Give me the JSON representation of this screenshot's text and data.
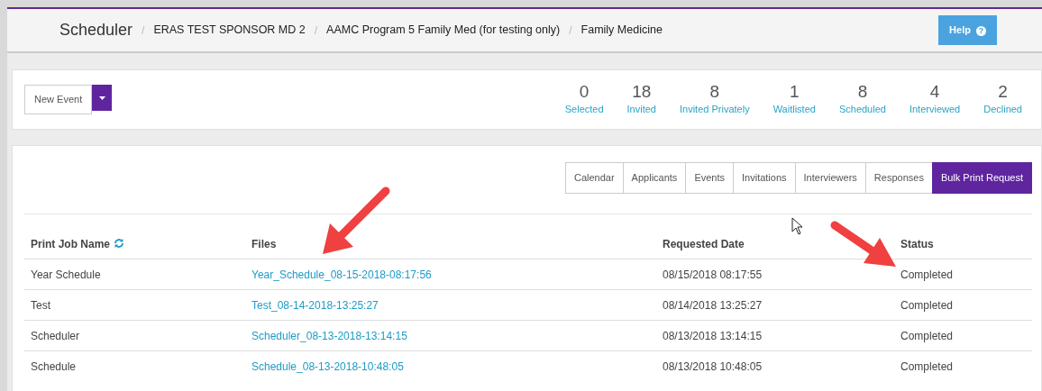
{
  "breadcrumb": [
    {
      "label": "Scheduler"
    },
    {
      "label": "ERAS TEST SPONSOR MD 2"
    },
    {
      "label": "AAMC Program 5 Family Med (for testing only)"
    },
    {
      "label": "Family Medicine"
    }
  ],
  "breadcrumb_separator": "/",
  "help_button": {
    "label": "Help",
    "icon": "?"
  },
  "new_event_button": {
    "label": "New Event"
  },
  "stats": [
    {
      "value": "0",
      "label": "Selected"
    },
    {
      "value": "18",
      "label": "Invited"
    },
    {
      "value": "8",
      "label": "Invited Privately"
    },
    {
      "value": "1",
      "label": "Waitlisted"
    },
    {
      "value": "8",
      "label": "Scheduled"
    },
    {
      "value": "4",
      "label": "Interviewed"
    },
    {
      "value": "2",
      "label": "Declined"
    }
  ],
  "tabs": [
    {
      "label": "Calendar",
      "selected": false
    },
    {
      "label": "Applicants",
      "selected": false
    },
    {
      "label": "Events",
      "selected": false
    },
    {
      "label": "Invitations",
      "selected": false
    },
    {
      "label": "Interviewers",
      "selected": false
    },
    {
      "label": "Responses",
      "selected": false
    },
    {
      "label": "Bulk Print Request",
      "selected": true
    }
  ],
  "table": {
    "columns": [
      "Print Job Name",
      "Files",
      "Requested Date",
      "Status"
    ],
    "rows": [
      [
        "Year Schedule",
        "Year_Schedule_08-15-2018-08:17:56",
        "08/15/2018 08:17:55",
        "Completed"
      ],
      [
        "Test",
        "Test_08-14-2018-13:25:27",
        "08/14/2018 13:25:27",
        "Completed"
      ],
      [
        "Scheduler",
        "Scheduler_08-13-2018-13:14:15",
        "08/13/2018 13:14:15",
        "Completed"
      ],
      [
        "Schedule",
        "Schedule_08-13-2018-10:48:05",
        "08/13/2018 10:48:05",
        "Completed"
      ]
    ]
  }
}
